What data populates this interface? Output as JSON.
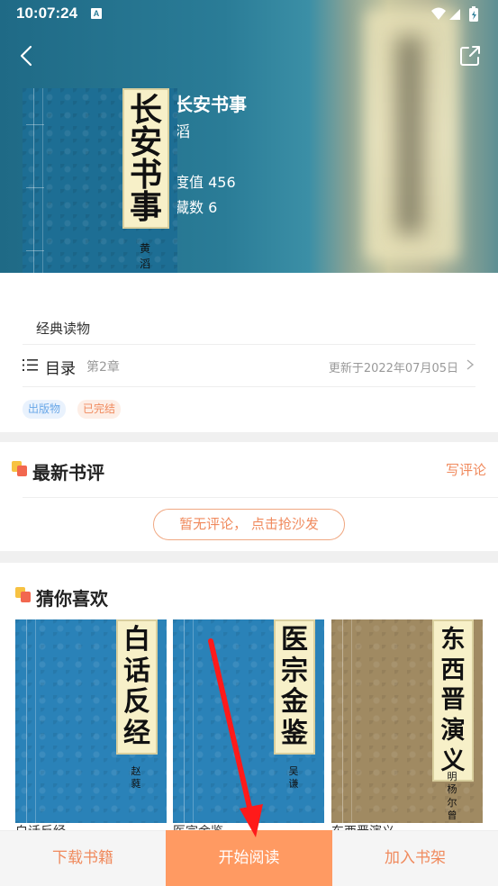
{
  "status_bar": {
    "time": "10:07:24",
    "notif_letter": "A"
  },
  "book": {
    "title": "长安书事",
    "title_visible": "长安书事",
    "author": "黄滔",
    "author_visible": "滔",
    "heat": "热度值 456",
    "heat_visible": "度值 456",
    "favorites": "收藏数 6",
    "favorites_visible": "藏数 6",
    "cover_chars": [
      "长",
      "安",
      "书",
      "事"
    ],
    "cover_author": "黄滔",
    "category": "经典读物"
  },
  "toc": {
    "label": "目录",
    "chapter": "第2章",
    "updated": "更新于2022年07月05日"
  },
  "tags": [
    "出版物",
    "已完结"
  ],
  "reviews": {
    "title": "最新书评",
    "write": "写评论",
    "empty": "暂无评论， 点击抢沙发"
  },
  "recommend": {
    "title": "猜你喜欢",
    "books": [
      {
        "chars": [
          "白",
          "话",
          "反",
          "经"
        ],
        "author": "赵蕤",
        "color": "#2a82b8",
        "name": "白话反经"
      },
      {
        "chars": [
          "医",
          "宗",
          "金",
          "鉴"
        ],
        "author": "吴谦",
        "color": "#2a82b8",
        "name": "医宗金鉴"
      },
      {
        "chars": [
          "东",
          "西",
          "晋",
          "演",
          "义"
        ],
        "author": "明 杨尔曾",
        "color": "#a08a62",
        "name": "东西晋演义"
      }
    ]
  },
  "bottom_bar": {
    "download": "下载书籍",
    "read": "开始阅读",
    "shelf": "加入书架"
  },
  "colors": {
    "accent": "#ff9a62",
    "accent_text": "#f08a5d",
    "annotation_arrow": "#ff1a1a"
  }
}
